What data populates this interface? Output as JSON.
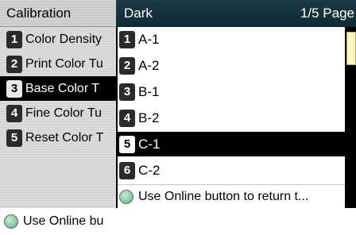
{
  "left_panel": {
    "title": "Calibration",
    "items": [
      {
        "num": "1",
        "label": "Color Density"
      },
      {
        "num": "2",
        "label": "Print Color Tu"
      },
      {
        "num": "3",
        "label": "Base Color T"
      },
      {
        "num": "4",
        "label": "Fine Color Tu"
      },
      {
        "num": "5",
        "label": "Reset Color T"
      }
    ],
    "footer": "Use Online bu"
  },
  "popup": {
    "title": "Dark",
    "page": "1/5 Page",
    "items": [
      {
        "num": "1",
        "label": "A-1"
      },
      {
        "num": "2",
        "label": "A-2"
      },
      {
        "num": "3",
        "label": "B-1"
      },
      {
        "num": "4",
        "label": "B-2"
      },
      {
        "num": "5",
        "label": "C-1"
      },
      {
        "num": "6",
        "label": "C-2"
      }
    ],
    "footer": "Use Online button to return t..."
  },
  "colors": {
    "header_bg": "#0e2a33",
    "selected_bg": "#000000",
    "scroll_thumb": "#fff7c2",
    "online_indicator": "#8cc8a4"
  }
}
